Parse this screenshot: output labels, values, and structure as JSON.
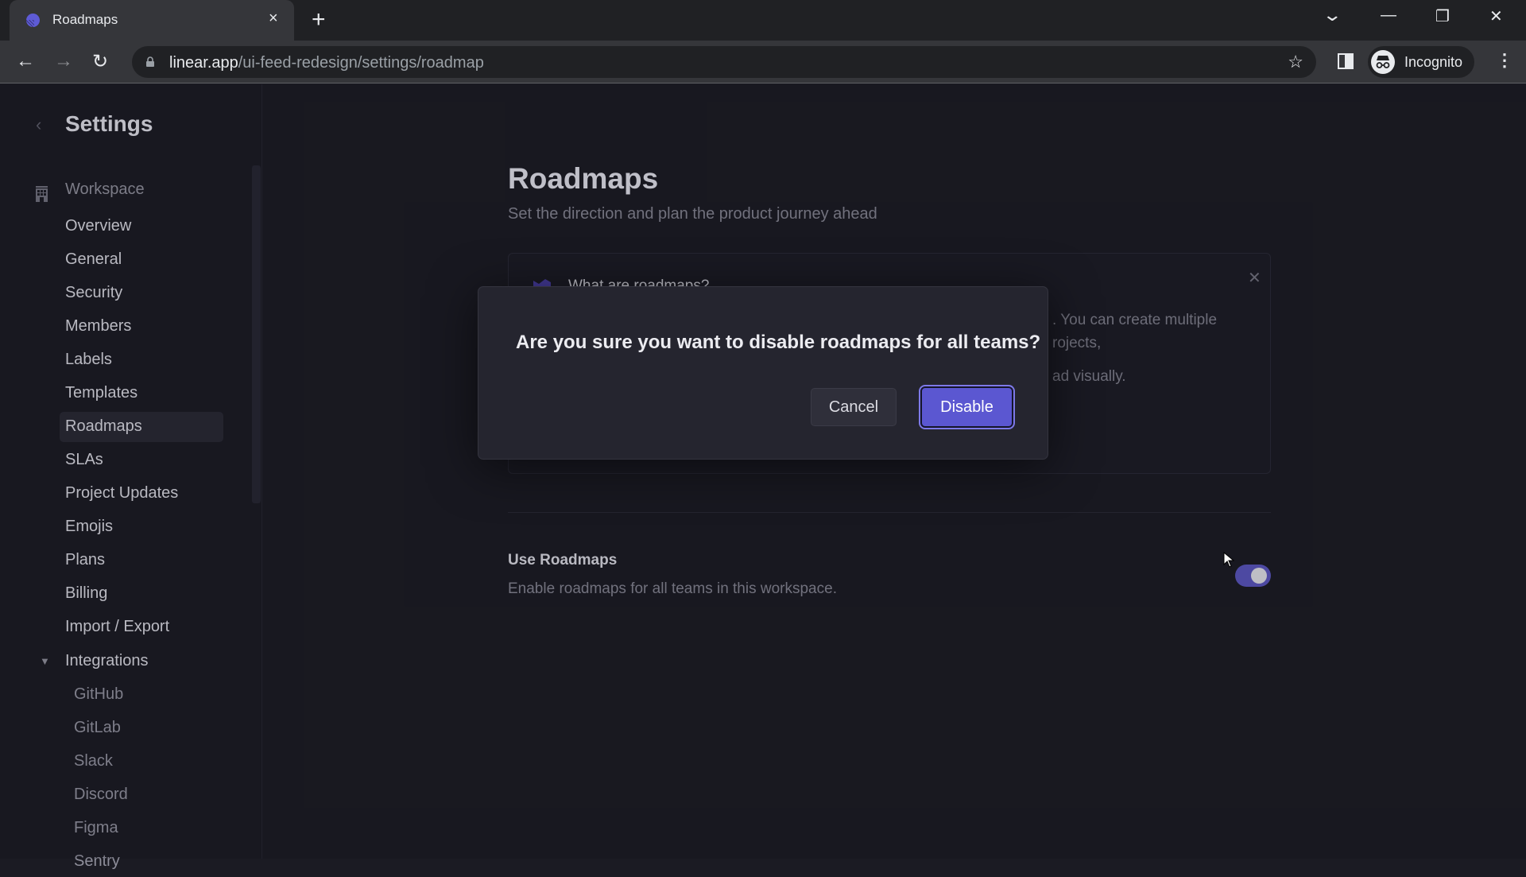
{
  "browser": {
    "tab_title": "Roadmaps",
    "url_host": "linear.app",
    "url_path": "/ui-feed-redesign/settings/roadmap",
    "profile_label": "Incognito",
    "icons": {
      "favicon": "linear-logo-icon",
      "tab_close": "×",
      "new_tab": "+",
      "back": "←",
      "forward": "→",
      "reload": "↻",
      "star": "☆",
      "kebab": "⋮",
      "tab_search": "⌄",
      "minimize": "—",
      "restore": "❐",
      "close": "✕"
    }
  },
  "sidebar": {
    "back_icon": "‹",
    "title": "Settings",
    "group_label": "Workspace",
    "items": [
      {
        "label": "Overview"
      },
      {
        "label": "General"
      },
      {
        "label": "Security"
      },
      {
        "label": "Members"
      },
      {
        "label": "Labels"
      },
      {
        "label": "Templates"
      },
      {
        "label": "Roadmaps",
        "active": true
      },
      {
        "label": "SLAs"
      },
      {
        "label": "Project Updates"
      },
      {
        "label": "Emojis"
      },
      {
        "label": "Plans"
      },
      {
        "label": "Billing"
      },
      {
        "label": "Import / Export"
      }
    ],
    "integrations": {
      "label": "Integrations",
      "caret": "▼",
      "items": [
        {
          "label": "GitHub"
        },
        {
          "label": "GitLab"
        },
        {
          "label": "Slack"
        },
        {
          "label": "Discord"
        },
        {
          "label": "Figma"
        },
        {
          "label": "Sentry"
        }
      ]
    }
  },
  "main": {
    "title": "Roadmaps",
    "subtitle": "Set the direction and plan the product journey ahead",
    "info_card": {
      "title": "What are roadmaps?",
      "close_icon": "✕",
      "visible_fragments": [
        ". You can create multiple",
        "rojects,",
        "ad visually."
      ]
    },
    "setting": {
      "title": "Use Roadmaps",
      "description": "Enable roadmaps for all teams in this workspace.",
      "enabled": true
    }
  },
  "dialog": {
    "message": "Are you sure you want to disable roadmaps for all teams?",
    "cancel_label": "Cancel",
    "confirm_label": "Disable"
  },
  "colors": {
    "accent": "#5b57d1",
    "background": "#1b1b23",
    "dialog": "#25252f"
  }
}
